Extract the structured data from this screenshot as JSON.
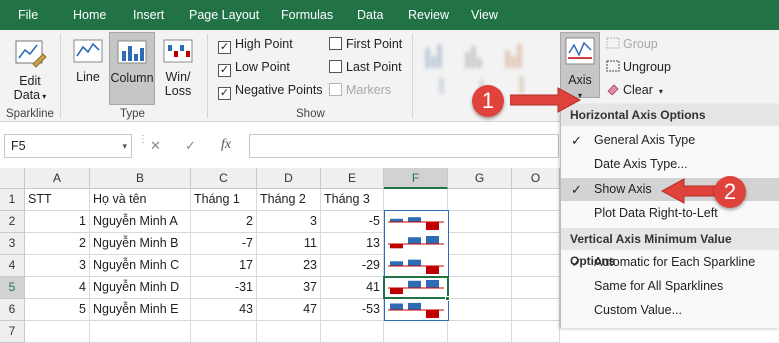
{
  "tabs": [
    "File",
    "Home",
    "Insert",
    "Page Layout",
    "Formulas",
    "Data",
    "Review",
    "View"
  ],
  "ribbon": {
    "sparkline_group": {
      "edit_data_line1": "Edit",
      "edit_data_line2": "Data",
      "label": "Sparkline"
    },
    "type_group": {
      "line": "Line",
      "column": "Column",
      "winloss_line1": "Win/",
      "winloss_line2": "Loss",
      "label": "Type"
    },
    "show_group": {
      "high_point": "High Point",
      "low_point": "Low Point",
      "negative_points": "Negative Points",
      "first_point": "First Point",
      "last_point": "Last Point",
      "markers": "Markers",
      "label": "Show",
      "checked": {
        "high_point": true,
        "low_point": true,
        "negative_points": true,
        "first_point": false,
        "last_point": false,
        "markers": false
      }
    },
    "group_group": {
      "axis": "Axis",
      "group": "Group",
      "ungroup": "Ungroup",
      "clear": "Clear"
    }
  },
  "formula_bar": {
    "name_box": "F5",
    "cancel": "✕",
    "enter": "✓",
    "fx": "fx",
    "formula": ""
  },
  "sheet": {
    "columns": [
      "A",
      "B",
      "C",
      "D",
      "E",
      "F",
      "G",
      "O"
    ],
    "rows": [
      "1",
      "2",
      "3",
      "4",
      "5",
      "6",
      "7"
    ],
    "header_row": [
      "STT",
      "Họ và tên",
      "Tháng 1",
      "Tháng 2",
      "Tháng 3"
    ],
    "data": [
      {
        "stt": "1",
        "name": "Nguyễn Minh A",
        "m1": "2",
        "m2": "3",
        "m3": "-5"
      },
      {
        "stt": "2",
        "name": "Nguyễn Minh B",
        "m1": "-7",
        "m2": "11",
        "m3": "13"
      },
      {
        "stt": "3",
        "name": "Nguyễn Minh C",
        "m1": "17",
        "m2": "23",
        "m3": "-29"
      },
      {
        "stt": "4",
        "name": "Nguyễn Minh D",
        "m1": "-31",
        "m2": "37",
        "m3": "41"
      },
      {
        "stt": "5",
        "name": "Nguyễn Minh E",
        "m1": "43",
        "m2": "47",
        "m3": "-53"
      }
    ]
  },
  "menu": {
    "horizontal_header": "Horizontal Axis Options",
    "general_axis": "General Axis Type",
    "date_axis": "Date Axis Type...",
    "show_axis": "Show Axis",
    "plot_rtl": "Plot Data Right-to-Left",
    "vertical_header": "Vertical Axis Minimum Value Options",
    "auto_each": "Automatic for Each Sparkline",
    "same_all": "Same for All Sparklines",
    "custom": "Custom Value...",
    "check": "✓"
  },
  "callouts": {
    "one": "1",
    "two": "2"
  },
  "colors": {
    "brand": "#217346",
    "positive": "#2e6db4",
    "negative": "#c00000",
    "callout": "#e0433c"
  }
}
